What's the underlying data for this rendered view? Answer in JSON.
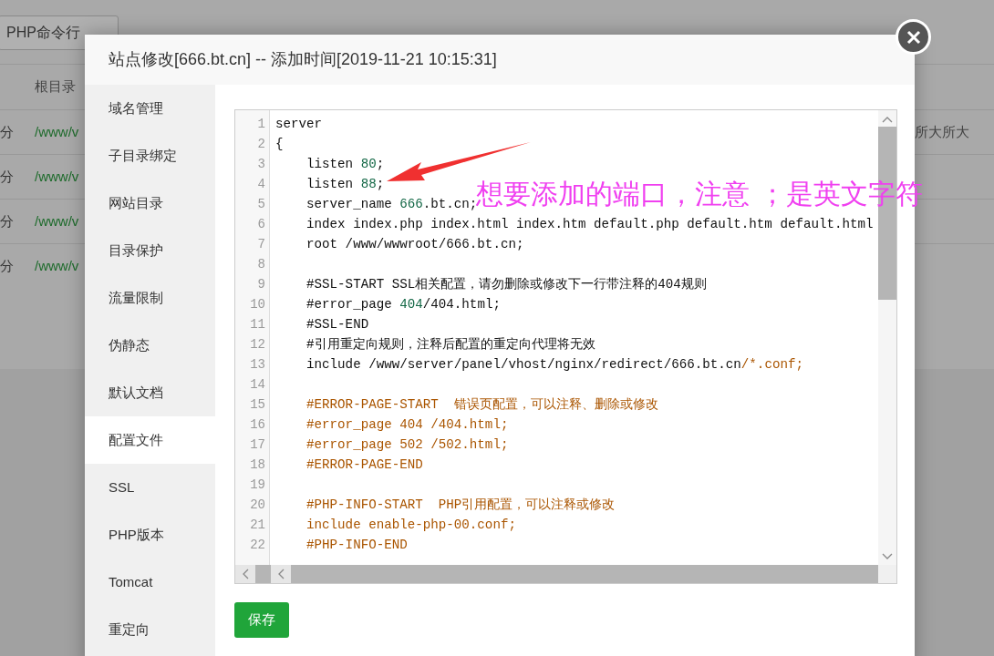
{
  "background": {
    "button": "PHP命令行",
    "column_header": "根目录",
    "rows": [
      {
        "column_1": "分",
        "path": "/www/v",
        "column_3": "所大所大"
      },
      {
        "column_1": "分",
        "path": "/www/v"
      },
      {
        "column_1": "分",
        "path": "/www/v"
      },
      {
        "column_1": "分",
        "path": "/www/v"
      }
    ]
  },
  "dialog": {
    "title": "站点修改[666.bt.cn] -- 添加时间[2019-11-21 10:15:31]",
    "sidebar": [
      {
        "label": "域名管理",
        "selected": false
      },
      {
        "label": "子目录绑定",
        "selected": false
      },
      {
        "label": "网站目录",
        "selected": false
      },
      {
        "label": "目录保护",
        "selected": false
      },
      {
        "label": "流量限制",
        "selected": false
      },
      {
        "label": "伪静态",
        "selected": false
      },
      {
        "label": "默认文档",
        "selected": false
      },
      {
        "label": "配置文件",
        "selected": true
      },
      {
        "label": "SSL",
        "selected": false
      },
      {
        "label": "PHP版本",
        "selected": false
      },
      {
        "label": "Tomcat",
        "selected": false
      },
      {
        "label": "重定向",
        "selected": false
      }
    ],
    "editor": {
      "lines": [
        {
          "number": "1",
          "segments": [
            {
              "kind": "plain",
              "text": "server"
            }
          ]
        },
        {
          "number": "2",
          "segments": [
            {
              "kind": "plain",
              "text": "{"
            }
          ]
        },
        {
          "number": "3",
          "segments": [
            {
              "kind": "plain",
              "text": "    listen "
            },
            {
              "kind": "number",
              "text": "80"
            },
            {
              "kind": "plain",
              "text": ";"
            }
          ]
        },
        {
          "number": "4",
          "segments": [
            {
              "kind": "plain",
              "text": "    listen "
            },
            {
              "kind": "number",
              "text": "88"
            },
            {
              "kind": "plain",
              "text": ";"
            }
          ]
        },
        {
          "number": "5",
          "segments": [
            {
              "kind": "plain",
              "text": "    server_name "
            },
            {
              "kind": "number",
              "text": "666"
            },
            {
              "kind": "plain",
              "text": ".bt.cn;"
            }
          ]
        },
        {
          "number": "6",
          "segments": [
            {
              "kind": "plain",
              "text": "    index index.php index.html index.htm default.php default.htm default.html"
            }
          ]
        },
        {
          "number": "7",
          "segments": [
            {
              "kind": "plain",
              "text": "    root /www/wwwroot/666.bt.cn;"
            }
          ]
        },
        {
          "number": "8"
        },
        {
          "number": "9",
          "segments": [
            {
              "kind": "plain",
              "text": "    #SSL-START SSL相关配置，请勿删除或修改下一行带注释的404规则"
            }
          ]
        },
        {
          "number": "10",
          "segments": [
            {
              "kind": "plain",
              "text": "    #error_page "
            },
            {
              "kind": "number",
              "text": "404"
            },
            {
              "kind": "plain",
              "text": "/404.html;"
            }
          ]
        },
        {
          "number": "11",
          "segments": [
            {
              "kind": "plain",
              "text": "    #SSL-END"
            }
          ]
        },
        {
          "number": "12",
          "segments": [
            {
              "kind": "plain",
              "text": "    #引用重定向规则，注释后配置的重定向代理将无效"
            }
          ]
        },
        {
          "number": "13",
          "segments": [
            {
              "kind": "plain",
              "text": "    include /www/server/panel/vhost/nginx/redirect/666.bt.cn"
            },
            {
              "kind": "comment",
              "text": "/*.conf;"
            }
          ]
        },
        {
          "number": "14"
        },
        {
          "number": "15",
          "segments": [
            {
              "kind": "comment",
              "text": "    #ERROR-PAGE-START  错误页配置，可以注释、删除或修改"
            }
          ]
        },
        {
          "number": "16",
          "segments": [
            {
              "kind": "comment",
              "text": "    #error_page 404 /404.html;"
            }
          ]
        },
        {
          "number": "17",
          "segments": [
            {
              "kind": "comment",
              "text": "    #error_page 502 /502.html;"
            }
          ]
        },
        {
          "number": "18",
          "segments": [
            {
              "kind": "comment",
              "text": "    #ERROR-PAGE-END"
            }
          ]
        },
        {
          "number": "19"
        },
        {
          "number": "20",
          "segments": [
            {
              "kind": "comment",
              "text": "    #PHP-INFO-START  PHP引用配置，可以注释或修改"
            }
          ]
        },
        {
          "number": "21",
          "segments": [
            {
              "kind": "comment",
              "text": "    include enable-php-00.conf;"
            }
          ]
        },
        {
          "number": "22",
          "segments": [
            {
              "kind": "comment",
              "text": "    #PHP-INFO-END"
            }
          ]
        }
      ]
    },
    "save_button": "保存"
  },
  "annotation": {
    "text": "想要添加的端口，注意 ；是英文字符"
  }
}
